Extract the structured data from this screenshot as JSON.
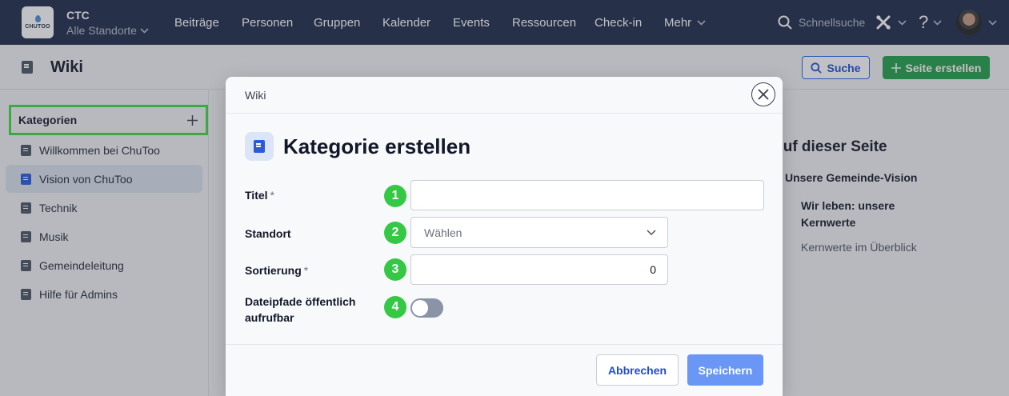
{
  "app": {
    "logo_text": "CHUTOO",
    "org_name": "CTC",
    "location_selector": "Alle Standorte"
  },
  "nav": {
    "items": [
      "Beiträge",
      "Personen",
      "Gruppen",
      "Kalender",
      "Events",
      "Ressourcen",
      "Check-in",
      "Mehr"
    ],
    "search_label": "Schnellsuche",
    "help_label": "?"
  },
  "page": {
    "title": "Wiki",
    "search_button": "Suche",
    "create_button": "Seite erstellen"
  },
  "sidebar": {
    "header": "Kategorien",
    "add_label": "+",
    "items": [
      {
        "label": "Willkommen bei ChuToo",
        "active": false
      },
      {
        "label": "Vision von ChuToo",
        "active": true
      },
      {
        "label": "Technik",
        "active": false
      },
      {
        "label": "Musik",
        "active": false
      },
      {
        "label": "Gemeindeleitung",
        "active": false
      },
      {
        "label": "Hilfe für Admins",
        "active": false
      }
    ]
  },
  "toc": {
    "title": "Auf dieser Seite",
    "items": [
      "Unsere Gemeinde-Vision",
      "Wir leben: unsere Kernwerte",
      "Kernwerte im Überblick"
    ]
  },
  "modal": {
    "breadcrumb": "Wiki",
    "title": "Kategorie erstellen",
    "fields": {
      "title": {
        "label": "Titel",
        "required_mark": "*",
        "badge": "1",
        "value": ""
      },
      "location": {
        "label": "Standort",
        "badge": "2",
        "placeholder": "Wählen"
      },
      "sort": {
        "label": "Sortierung",
        "required_mark": "*",
        "badge": "3",
        "value": "0"
      },
      "public_paths": {
        "label_line1": "Dateipfade öffentlich",
        "label_line2": "aufrufbar",
        "badge": "4",
        "enabled": false
      }
    },
    "cancel_button": "Abbrechen",
    "save_button": "Speichern"
  },
  "colors": {
    "nav_bg": "#1e2a4a",
    "primary": "#2563eb",
    "success": "#22a04b",
    "highlight": "#3ddc42",
    "badge": "#35c845",
    "save_button": "#6a96f5"
  }
}
